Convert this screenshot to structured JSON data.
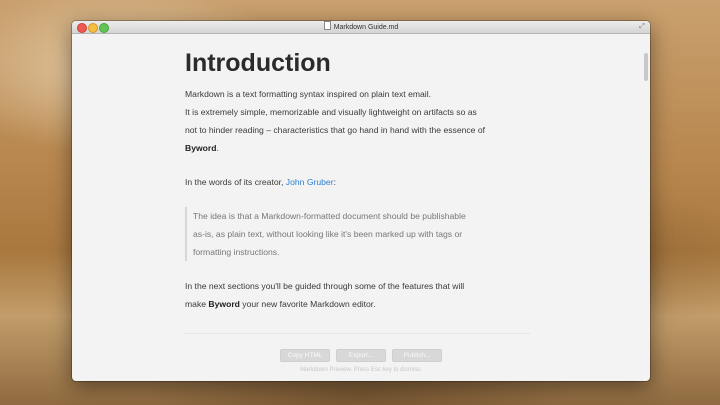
{
  "window": {
    "title": "Markdown Guide.md"
  },
  "content": {
    "heading": "Introduction",
    "intro_lines": [
      "Markdown is a text formatting syntax inspired on plain text email.",
      "It is extremely simple, memorizable and visually lightweight on artifacts so as",
      "not to hinder reading – characteristics that go hand in hand with the essence of"
    ],
    "intro_bold": "Byword",
    "intro_end": ".",
    "creator_prefix": "In the words of its creator, ",
    "creator_link": "John Gruber",
    "creator_suffix": ":",
    "quote_lines": [
      "The idea is that a Markdown-formatted document should be publishable",
      "as-is, as plain text, without looking like it's been marked up with tags or",
      "formatting instructions."
    ],
    "next_line1": "In the next sections you'll be guided through some of the features that will",
    "next_prefix": "make ",
    "next_bold": "Byword",
    "next_suffix": " your new favorite Markdown editor."
  },
  "footer": {
    "buttons": [
      "Copy HTML",
      "Export...",
      "Publish..."
    ],
    "hint": "Markdown Preview. Press Esc key to dismiss."
  },
  "icons": {
    "close": "close-icon",
    "minimize": "minimize-icon",
    "zoom": "zoom-icon",
    "document": "document-icon",
    "fullscreen": "fullscreen-icon"
  }
}
